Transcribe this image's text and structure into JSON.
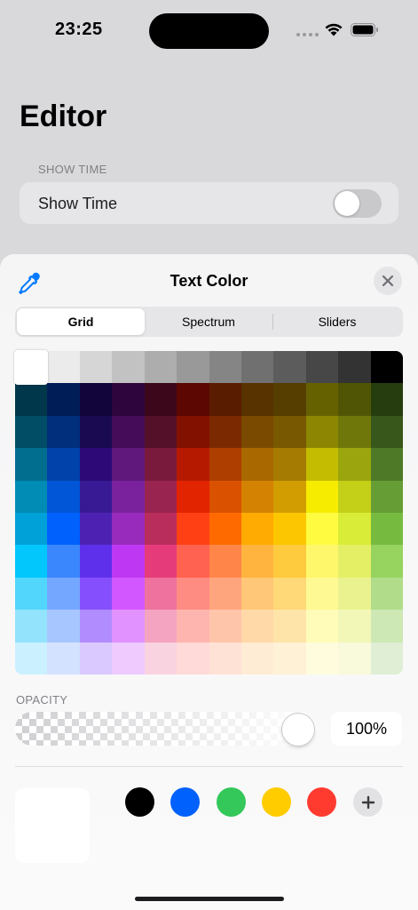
{
  "status_bar": {
    "time": "23:25"
  },
  "editor": {
    "title": "Editor",
    "section_header": "SHOW TIME",
    "show_time_label": "Show Time",
    "show_time_enabled": false
  },
  "color_picker": {
    "title": "Text Color",
    "tabs": [
      {
        "label": "Grid",
        "selected": true
      },
      {
        "label": "Spectrum",
        "selected": false
      },
      {
        "label": "Sliders",
        "selected": false
      }
    ],
    "grid_colors": [
      [
        "#ffffff",
        "#ebebeb",
        "#d6d6d6",
        "#c2c2c2",
        "#adadad",
        "#999999",
        "#858585",
        "#707070",
        "#5c5c5c",
        "#474747",
        "#333333",
        "#000000"
      ],
      [
        "#00374a",
        "#011d57",
        "#11053b",
        "#2e063d",
        "#3c071b",
        "#5c0701",
        "#5a1c00",
        "#583300",
        "#563d00",
        "#666100",
        "#4f5504",
        "#263e0f"
      ],
      [
        "#004d65",
        "#012f7b",
        "#1a0a52",
        "#450d59",
        "#551029",
        "#831100",
        "#7b2900",
        "#7a4a00",
        "#785800",
        "#8c8602",
        "#6f760a",
        "#38571a"
      ],
      [
        "#016e8f",
        "#0042a9",
        "#2c0977",
        "#61187c",
        "#791a3d",
        "#b51a00",
        "#ad3e00",
        "#a96800",
        "#a67b01",
        "#c4bc00",
        "#9ba50e",
        "#4e7a27"
      ],
      [
        "#008cb4",
        "#0056d6",
        "#371a94",
        "#7a219e",
        "#99244f",
        "#e22400",
        "#da5100",
        "#d38301",
        "#d19d01",
        "#f5ec00",
        "#c3d017",
        "#669d34"
      ],
      [
        "#00a1d8",
        "#0061fd",
        "#4d22b2",
        "#982abc",
        "#b92d5d",
        "#ff4015",
        "#ff6a00",
        "#ffab01",
        "#fcc700",
        "#fefb41",
        "#d9ec37",
        "#76bb40"
      ],
      [
        "#01c7fc",
        "#3a87fd",
        "#5e30eb",
        "#be38f3",
        "#e63b7a",
        "#ff6250",
        "#ff8648",
        "#feb43f",
        "#fecb3e",
        "#fff76b",
        "#e4ef65",
        "#96d35f"
      ],
      [
        "#52d6fc",
        "#74a7ff",
        "#864ffd",
        "#d357fe",
        "#ee719e",
        "#ff8c82",
        "#ffa57d",
        "#ffc777",
        "#ffd977",
        "#fff994",
        "#eaf28f",
        "#b1dd8b"
      ],
      [
        "#93e3fc",
        "#a7c6ff",
        "#b18cfe",
        "#e292fe",
        "#f4a4c0",
        "#ffb5af",
        "#ffc5ab",
        "#ffd9a8",
        "#fee4a8",
        "#fffbb9",
        "#f2f7b7",
        "#cde8b5"
      ],
      [
        "#cbf0ff",
        "#d3e2ff",
        "#d9c9fe",
        "#efcaff",
        "#f9d3e0",
        "#ffdad8",
        "#ffe2d6",
        "#ffecd4",
        "#fef1d5",
        "#fefcdd",
        "#f8fadb",
        "#dfeed4"
      ]
    ],
    "selected_color": "#ffffff",
    "opacity_label": "OPACITY",
    "opacity_value": "100%",
    "opacity_fraction": 1.0,
    "saved_colors": [
      {
        "name": "black",
        "hex": "#000000"
      },
      {
        "name": "blue",
        "hex": "#0061fd"
      },
      {
        "name": "green",
        "hex": "#34c759"
      },
      {
        "name": "yellow",
        "hex": "#ffcc00"
      },
      {
        "name": "red",
        "hex": "#ff3b30"
      }
    ],
    "icons": {
      "eyedropper": "eyedropper-icon",
      "close": "close-icon",
      "add": "plus-icon"
    },
    "accent_color": "#007aff"
  }
}
